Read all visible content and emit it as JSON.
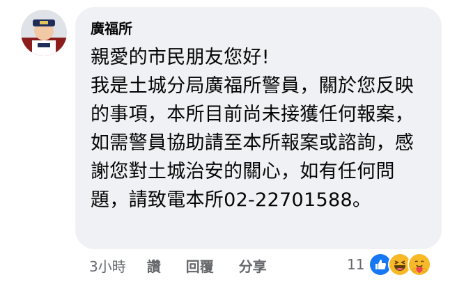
{
  "comment": {
    "author": "廣福所",
    "body": "親愛的市民朋友您好!\n我是土城分局廣福所警員，關於您反映的事項，本所目前尚未接獲任何報案，如需警員協助請至本所報案或諮詢，感謝您對土城治安的關心，如有任何問題，請致電本所02-22701588。",
    "avatar_icon": "police-avatar-icon"
  },
  "actions": {
    "time": "3小時",
    "like": "讚",
    "reply": "回覆",
    "share": "分享"
  },
  "reactions": {
    "count": "11",
    "icons": [
      "like-reaction-icon",
      "haha-reaction-icon",
      "care-reaction-icon"
    ]
  },
  "colors": {
    "bubble_bg": "#eff1f4",
    "meta_text": "#65676b",
    "like_blue": "#1877f2",
    "emoji_yellow": "#f7b928"
  }
}
